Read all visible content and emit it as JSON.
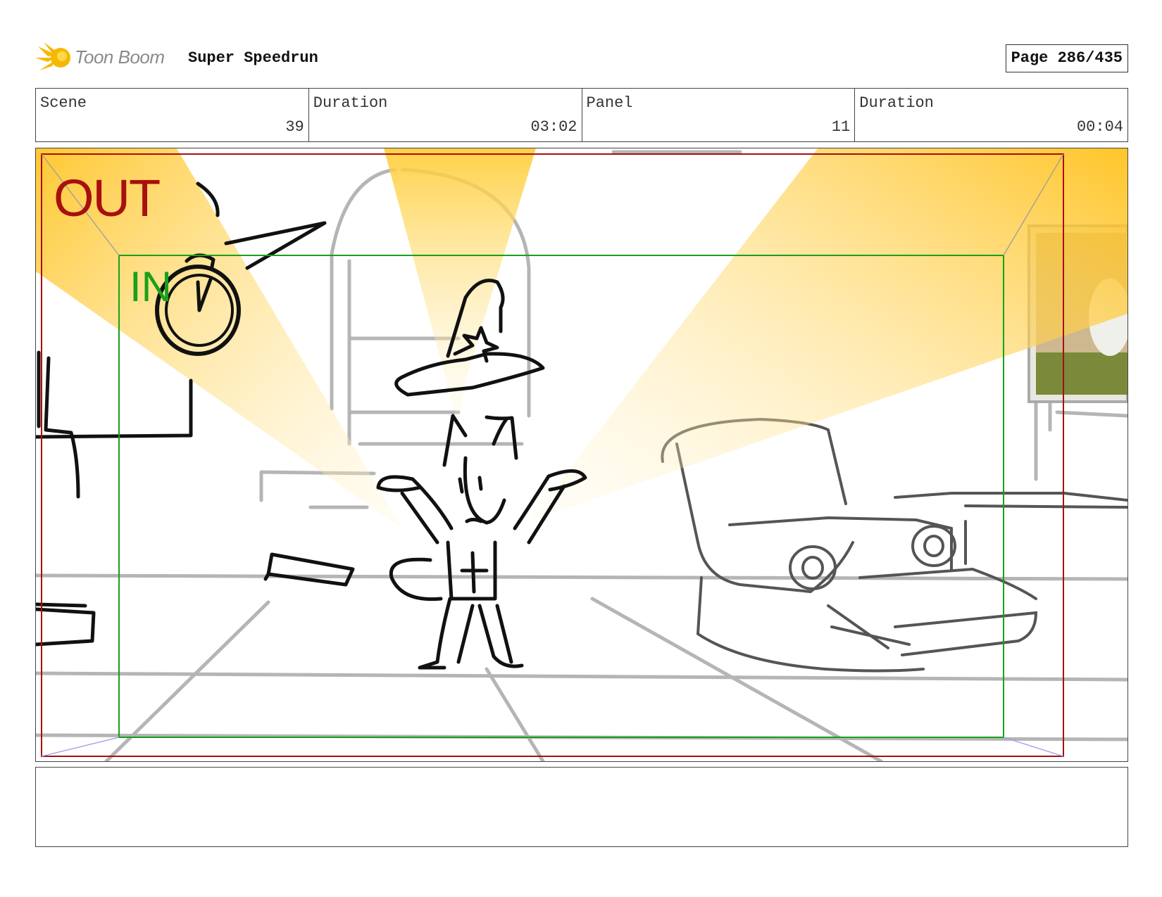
{
  "header": {
    "logo_text": "Toon Boom",
    "project_title": "Super Speedrun",
    "page_label": "Page 286/435"
  },
  "info": [
    {
      "label": "Scene",
      "value": "39"
    },
    {
      "label": "Duration",
      "value": "03:02"
    },
    {
      "label": "Panel",
      "value": "11"
    },
    {
      "label": "Duration",
      "value": "00:04"
    }
  ],
  "panel": {
    "out_label": "OUT",
    "in_label": "IN"
  },
  "notes": {
    "text": ""
  },
  "colors": {
    "out_frame": "#a80f0f",
    "in_frame": "#19a019",
    "spotlight": "#ffc21a"
  },
  "icons": [
    "toon-boom-logo-icon",
    "stopwatch-icon"
  ]
}
